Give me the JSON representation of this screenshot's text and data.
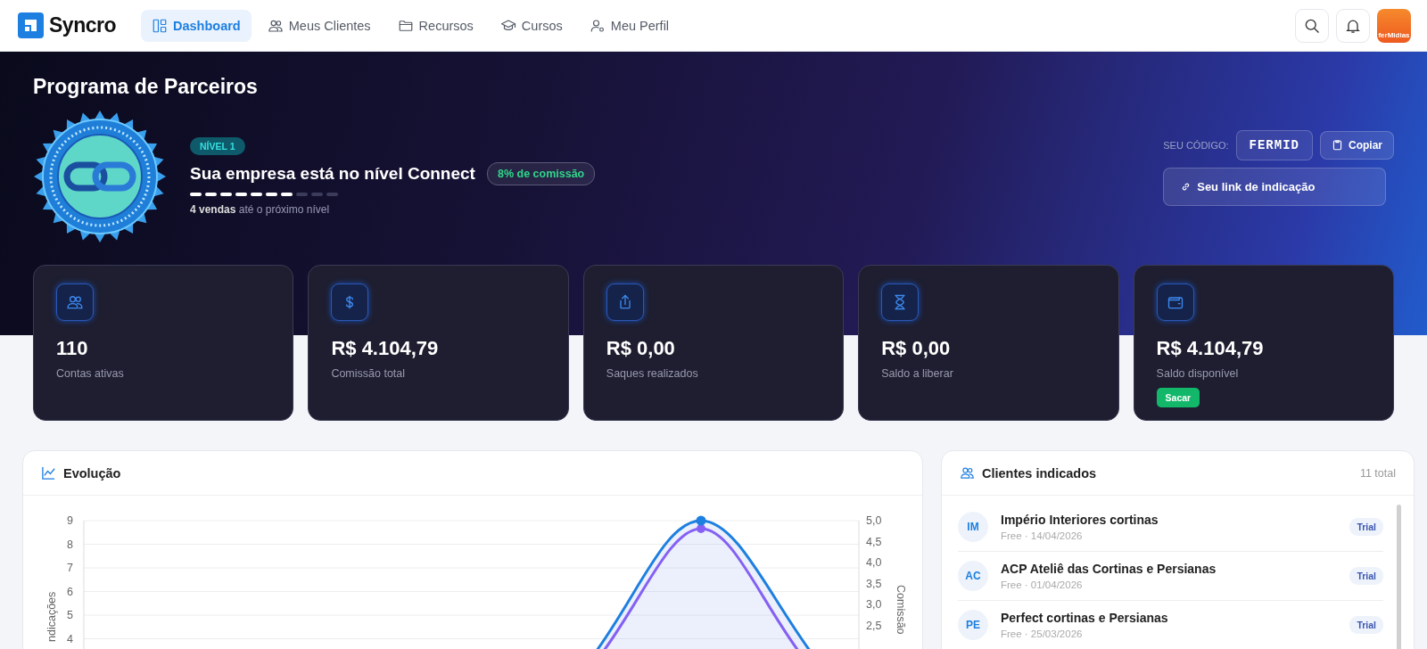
{
  "brand": {
    "name": "Syncro"
  },
  "nav": [
    {
      "label": "Dashboard",
      "selected": true
    },
    {
      "label": "Meus Clientes",
      "selected": false
    },
    {
      "label": "Recursos",
      "selected": false
    },
    {
      "label": "Cursos",
      "selected": false
    },
    {
      "label": "Meu Perfil",
      "selected": false
    }
  ],
  "account": {
    "logo_text": "ferMidias"
  },
  "hero": {
    "title": "Programa de Parceiros",
    "level_badge": "NÍVEL 1",
    "level_title": "Sua empresa está no nível Connect",
    "commission_badge": "8% de comissão",
    "level": 0.7,
    "progress_note": "**4 vendas** até o próximo nível",
    "code_label": "SEU CÓDIGO:",
    "code": "FERMID",
    "copy_button": "Copiar",
    "link_button": "Seu link de indicação"
  },
  "stats": [
    {
      "value": "110",
      "label": "Contas ativas"
    },
    {
      "value": "R$ 4.104,79",
      "label": "Comissão total"
    },
    {
      "value": "R$ 0,00",
      "label": "Saques realizados"
    },
    {
      "value": "R$ 0,00",
      "label": "Saldo a liberar"
    },
    {
      "value": "R$ 4.104,79",
      "label": "Saldo disponível",
      "action": "Sacar"
    }
  ],
  "evolution": {
    "title": "Evolução",
    "left_ticks": [
      "9",
      "8",
      "7",
      "6",
      "5",
      "4"
    ],
    "right_ticks": [
      "5,0",
      "4,5",
      "4,0",
      "3,5",
      "3,0",
      "2,5"
    ],
    "left_axis_label": "ndicações",
    "right_axis_label": "Comissão"
  },
  "clients": {
    "title": "Clientes indicados",
    "total": "11 total",
    "items": [
      {
        "initials": "IM",
        "name": "Império Interiores cortinas",
        "sub": "Free · 14/04/2026",
        "status": "Trial"
      },
      {
        "initials": "AC",
        "name": "ACP Ateliê das Cortinas e Persianas",
        "sub": "Free · 01/04/2026",
        "status": "Trial"
      },
      {
        "initials": "PE",
        "name": "Perfect cortinas e Persianas",
        "sub": "Free · 25/03/2026",
        "status": "Trial"
      }
    ]
  }
}
